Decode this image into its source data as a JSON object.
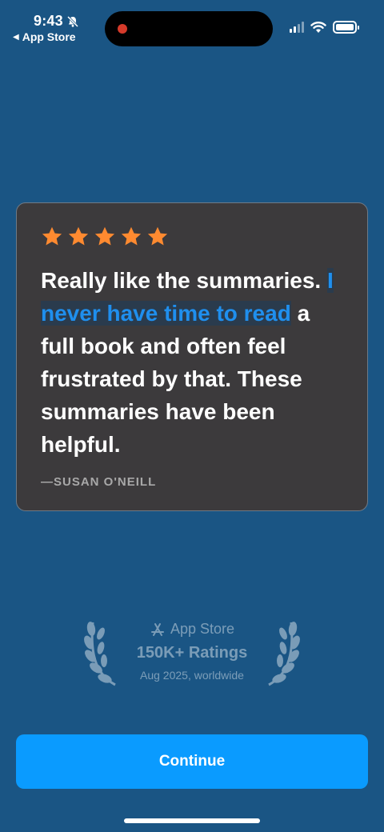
{
  "status_bar": {
    "time": "9:43",
    "back_label": "App Store"
  },
  "review": {
    "rating": 5,
    "quote_intro": "Really like the summaries. ",
    "quote_highlight": "I never have time to read",
    "quote_rest": " a full book and often feel frustrated by that. These summaries have been helpful.",
    "author": "—SUSAN O'NEILL",
    "star_color": "#ff8a30",
    "highlight_color": "#1f8fee"
  },
  "badge": {
    "store": "App Store",
    "ratings": "150K+ Ratings",
    "subtitle": "Aug 2025, worldwide"
  },
  "continue_label": "Continue",
  "colors": {
    "background": "#1a5584",
    "card": "#3c3a3c",
    "button": "#0a9bff"
  },
  "icons": [
    "bell-slash-icon",
    "back-triangle-icon",
    "signal-icon",
    "wifi-icon",
    "battery-icon",
    "star-icon",
    "app-store-icon",
    "laurel-icon"
  ]
}
